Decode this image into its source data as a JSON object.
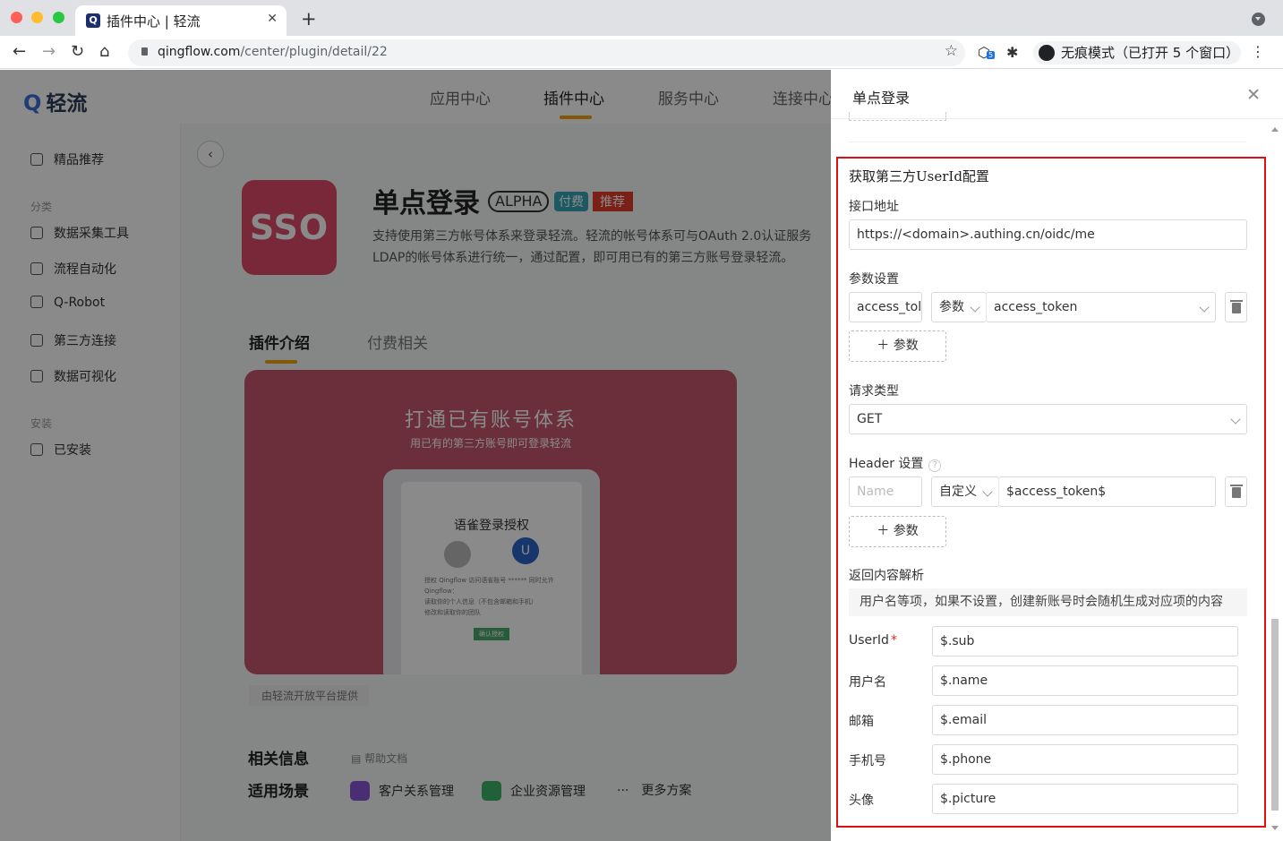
{
  "browser": {
    "tab_title": "插件中心 | 轻流",
    "tab_favicon": "Q",
    "url_host": "qingflow.com",
    "url_path": "/center/plugin/detail/22",
    "incognito_label": "无痕模式（已打开 5 个窗口）",
    "extension_badge": "5",
    "colors": {
      "close": "#ff5f57",
      "minimize": "#febc2e",
      "maximize": "#28c840"
    }
  },
  "header": {
    "logo_text": "轻流",
    "nav": [
      "应用中心",
      "插件中心",
      "服务中心",
      "连接中心"
    ],
    "active_nav": "插件中心",
    "accent_color": "#f0a20a"
  },
  "sidebar": {
    "featured": "精品推荐",
    "group_category": "分类",
    "categories": [
      "数据采集工具",
      "流程自动化",
      "Q-Robot",
      "第三方连接",
      "数据可视化"
    ],
    "group_installed": "安装",
    "installed": "已安装"
  },
  "plugin": {
    "icon_text": "SSO",
    "title": "单点登录",
    "badge_alpha": "ALPHA",
    "badge_paid": "付费",
    "badge_recommend": "推荐",
    "description": "支持使用第三方帐号体系来登录轻流。轻流的帐号体系可与OAuth 2.0认证服务LDAP的帐号体系进行统一，通过配置，即可用已有的第三方账号登录轻流。",
    "tabs": [
      "插件介绍",
      "付费相关"
    ],
    "banner_title": "打通已有账号体系",
    "banner_subtitle": "用已有的第三方账号即可登录轻流",
    "screen_title": "语雀登录授权",
    "screen_avatar": "U",
    "screen_text": "授权 Qingflow 访问语雀账号 ****** 同时允许 Qingflow：",
    "screen_item1": "读取你的个人信息（不包含邮箱和手机）",
    "screen_item2": "修改和读取你的团队",
    "screen_button": "确认授权",
    "provided_by": "由轻流开放平台提供",
    "related_info": "相关信息",
    "help_doc": "帮助文档",
    "scenes_title": "适用场景",
    "scenes": [
      "客户关系管理",
      "企业资源管理",
      "更多方案"
    ],
    "colors": {
      "icon_bg": "#e04a6a",
      "paid": "#37a5b7",
      "recommend": "#e23b2b",
      "banner": "#c4586b"
    }
  },
  "drawer": {
    "title": "单点登录",
    "section_title": "获取第三方UserId配置",
    "api_label": "接口地址",
    "api_url": "https://<domain>.authing.cn/oidc/me",
    "params_label": "参数设置",
    "param_name": "access_tol",
    "param_type": "参数",
    "param_value": "access_token",
    "add_param": "＋ 参数",
    "request_type_label": "请求类型",
    "request_type": "GET",
    "header_label": "Header 设置",
    "header_name_placeholder": "Name",
    "header_type": "自定义",
    "header_value": "$access_token$",
    "add_header": "＋ 参数",
    "response_label": "返回内容解析",
    "response_note": "用户名等项，如果不设置，创建新账号时会随机生成对应项的内容",
    "fields": [
      {
        "label": "UserId",
        "value": "$.sub",
        "required": true
      },
      {
        "label": "用户名",
        "value": "$.name"
      },
      {
        "label": "邮箱",
        "value": "$.email"
      },
      {
        "label": "手机号",
        "value": "$.phone"
      },
      {
        "label": "头像",
        "value": "$.picture"
      }
    ],
    "highlight_color": "#dd1111"
  }
}
